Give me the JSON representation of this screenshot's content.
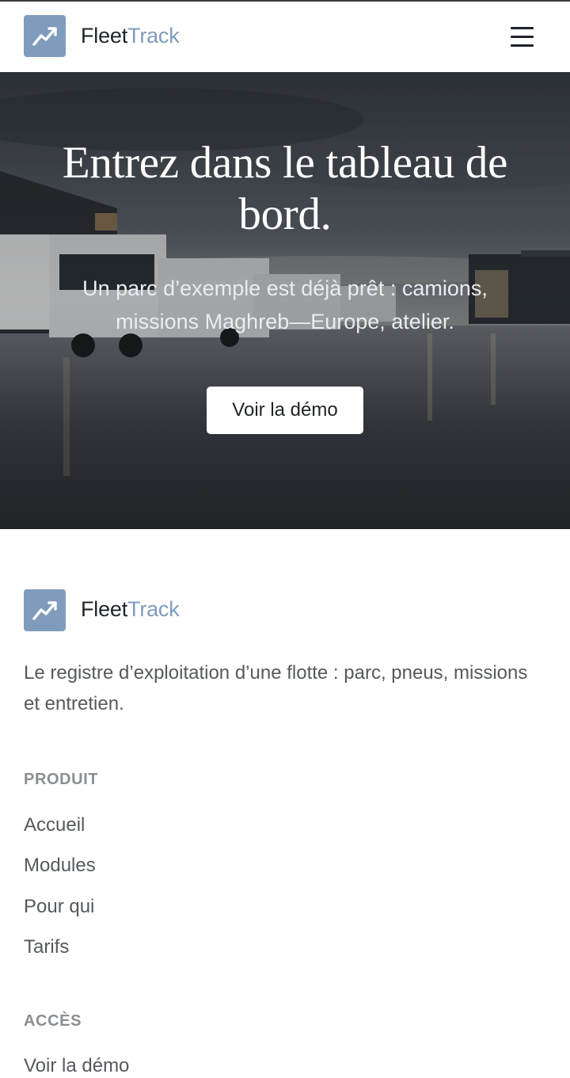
{
  "header": {
    "brand_part1": "Fleet",
    "brand_part2": "Track",
    "logo_icon": "trend-up-icon",
    "menu_icon": "hamburger-icon"
  },
  "hero": {
    "title": "Entrez dans le tableau de bord.",
    "subtitle": "Un parc d’exemple est déjà prêt : camions, missions Maghreb—Europe, atelier.",
    "cta_label": "Voir la démo"
  },
  "footer": {
    "brand_part1": "Fleet",
    "brand_part2": "Track",
    "tagline": "Le registre d’exploitation d’une flotte : parc, pneus, missions et entretien.",
    "sections": [
      {
        "heading": "PRODUIT",
        "links": [
          "Accueil",
          "Modules",
          "Pour qui",
          "Tarifs"
        ]
      },
      {
        "heading": "ACCÈS",
        "links": [
          "Voir la démo"
        ]
      }
    ]
  },
  "colors": {
    "accent": "#7f9cbd",
    "text": "#1f2328",
    "muted": "#55595e",
    "heading_muted": "#8a8f94"
  }
}
